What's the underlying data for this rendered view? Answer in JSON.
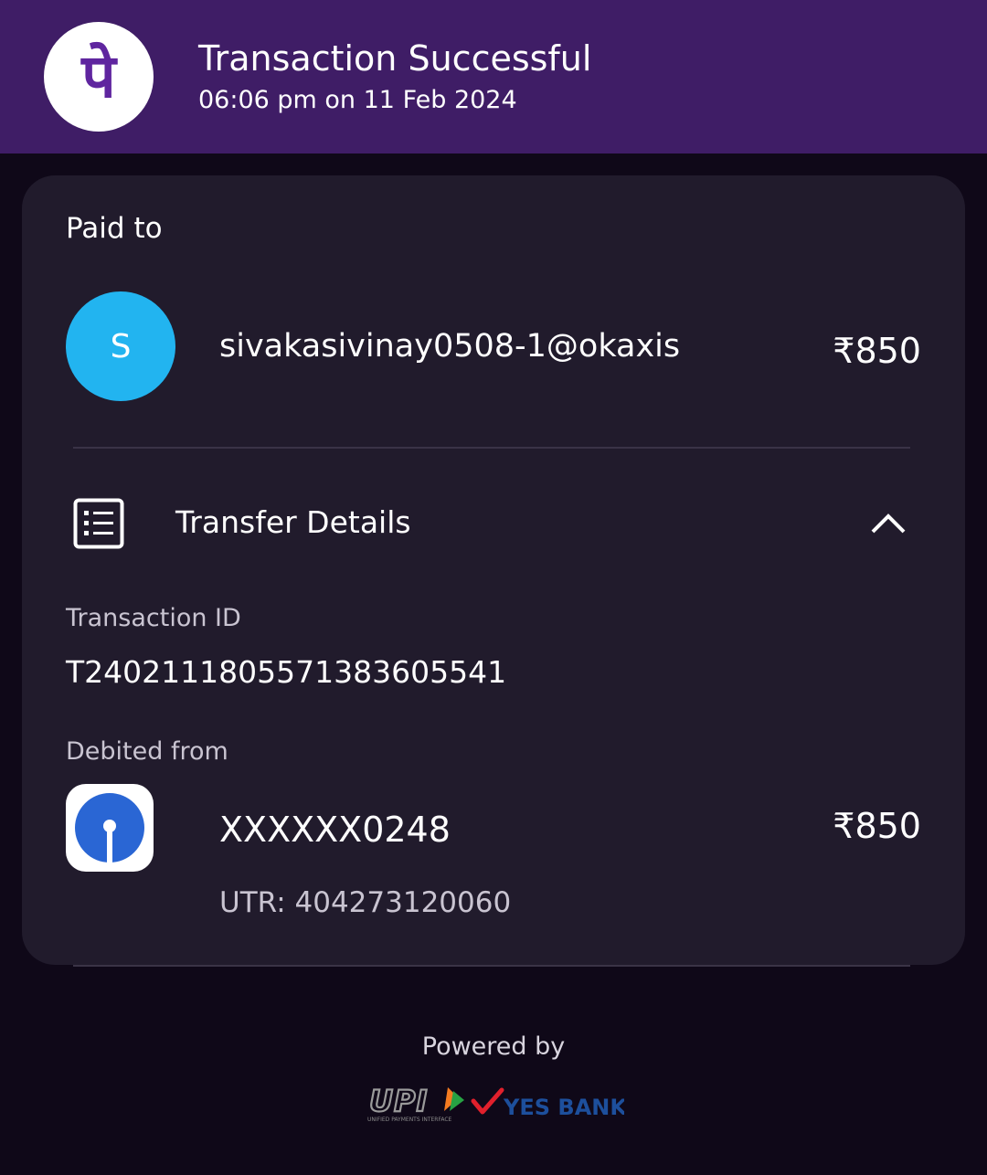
{
  "header": {
    "title": "Transaction Successful",
    "datetime": "06:06 pm on 11 Feb 2024",
    "logo_glyph": "पे",
    "brand_color": "#3f1d66",
    "logo_color": "#5f259f"
  },
  "paid_to": {
    "label": "Paid to",
    "avatar_letter": "S",
    "avatar_color": "#22b4f0",
    "payee": "sivakasivinay0508-1@okaxis",
    "amount": "₹850"
  },
  "transfer_details": {
    "title": "Transfer Details",
    "icon": "receipt-list-icon",
    "toggle_icon": "chevron-up-icon",
    "transaction_id_label": "Transaction ID",
    "transaction_id": "T2402111805571383605541",
    "debited_from_label": "Debited from",
    "account": "XXXXXX0248",
    "amount": "₹850",
    "utr": "UTR: 404273120060",
    "bank_icon": "sbi-logo-icon"
  },
  "footer": {
    "powered_by": "Powered by",
    "upi_text": "UPI",
    "upi_subtext": "UNIFIED PAYMENTS INTERFACE",
    "partner_bank": "YES BANK"
  }
}
